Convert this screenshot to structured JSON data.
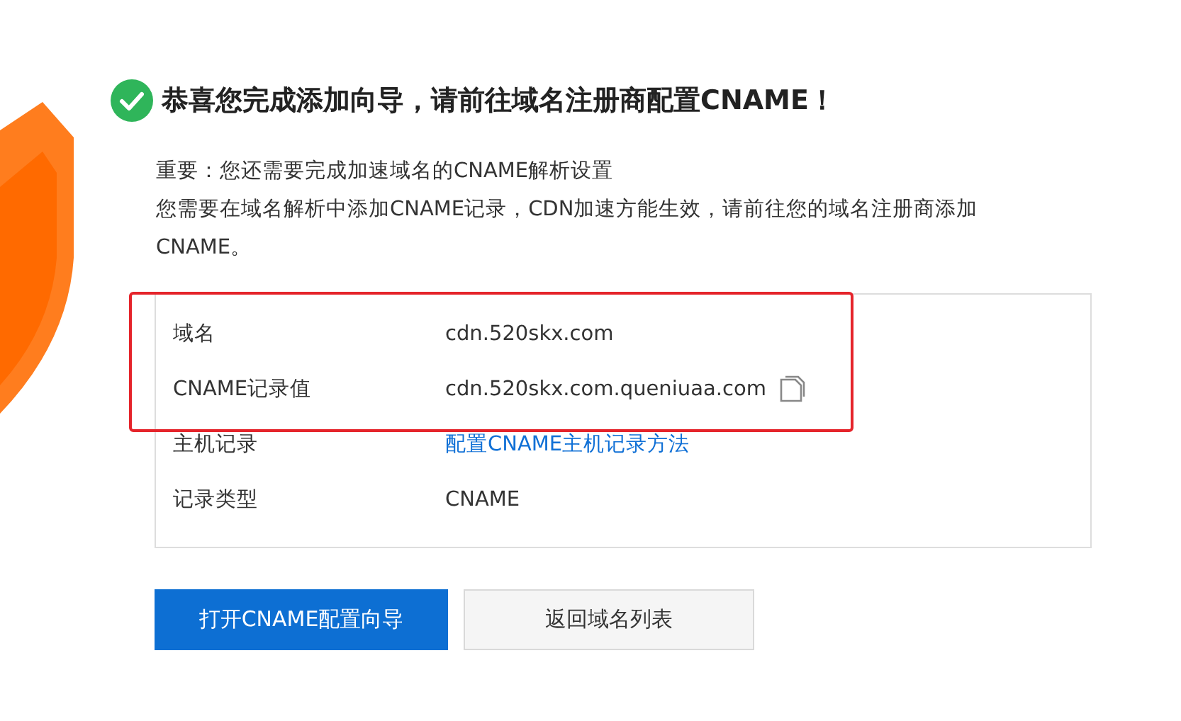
{
  "title": "恭喜您完成添加向导，请前往域名注册商配置CNAME！",
  "notice": [
    "重要：您还需要完成加速域名的CNAME解析设置",
    "您需要在域名解析中添加CNAME记录，CDN加速方能生效，请前往您的域名注册商添加CNAME。"
  ],
  "records": [
    {
      "label": "域名",
      "value": "cdn.520skx.com",
      "kind": "text",
      "copyable": false,
      "highlighted": true
    },
    {
      "label": "CNAME记录值",
      "value": "cdn.520skx.com.queniuaa.com",
      "kind": "text",
      "copyable": true,
      "highlighted": true
    },
    {
      "label": "主机记录",
      "value": "配置CNAME主机记录方法",
      "kind": "link",
      "copyable": false,
      "highlighted": false
    },
    {
      "label": "记录类型",
      "value": "CNAME",
      "kind": "text",
      "copyable": false,
      "highlighted": false
    }
  ],
  "buttons": [
    {
      "label": "打开CNAME配置向导",
      "kind": "primary"
    },
    {
      "label": "返回域名列表",
      "kind": "secondary"
    }
  ]
}
